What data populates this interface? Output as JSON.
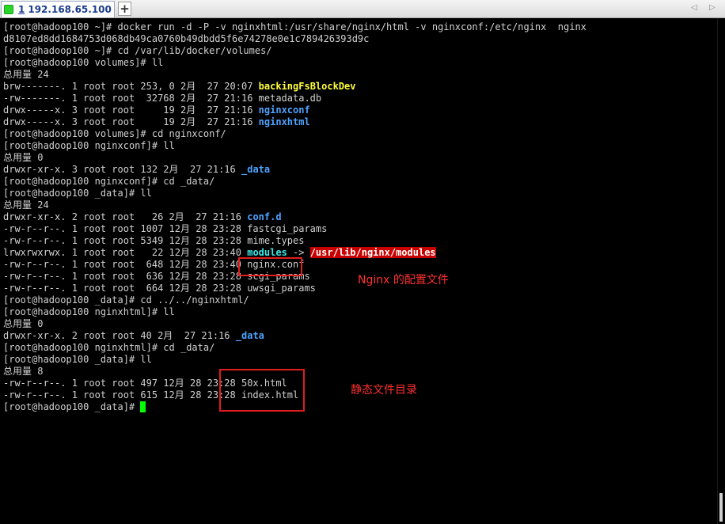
{
  "tab": {
    "number": "1",
    "title": "192.168.65.100",
    "close_glyph": "×",
    "add_glyph": "+",
    "nav_prev": "◁",
    "nav_next": "▷"
  },
  "colors": {
    "background": "#000000",
    "text": "#d0d0d0",
    "directory": "#4ea3ff",
    "device": "#ffff3c",
    "symlink": "#3ce8e8",
    "symlink_target_bg": "#c80000",
    "cursor": "#00ff00",
    "annotation": "#e01e1e"
  },
  "terminal": {
    "lines": [
      "[root@hadoop100 ~]# docker run -d -P -v nginxhtml:/usr/share/nginx/html -v nginxconf:/etc/nginx  nginx",
      "d8107ed8dd1684753d068db49ca0760b49dbdd5f6e74278e0e1c789426393d9c",
      "[root@hadoop100 ~]# cd /var/lib/docker/volumes/",
      "[root@hadoop100 volumes]# ll",
      "总用量 24",
      {
        "prefix": "brw-------. 1 root root 253, 0 2月  27 20:07 ",
        "name": "backingFsBlockDev",
        "type": "device"
      },
      "-rw-------. 1 root root  32768 2月  27 21:16 metadata.db",
      {
        "prefix": "drwx-----x. 3 root root     19 2月  27 21:16 ",
        "name": "nginxconf",
        "type": "directory"
      },
      {
        "prefix": "drwx-----x. 3 root root     19 2月  27 21:16 ",
        "name": "nginxhtml",
        "type": "directory"
      },
      "[root@hadoop100 volumes]# cd nginxconf/",
      "[root@hadoop100 nginxconf]# ll",
      "总用量 0",
      {
        "prefix": "drwxr-xr-x. 3 root root 132 2月  27 21:16 ",
        "name": "_data",
        "type": "directory"
      },
      "[root@hadoop100 nginxconf]# cd _data/",
      "[root@hadoop100 _data]# ll",
      "总用量 24",
      {
        "prefix": "drwxr-xr-x. 2 root root   26 2月  27 21:16 ",
        "name": "conf.d",
        "type": "directory"
      },
      "-rw-r--r--. 1 root root 1007 12月 28 23:28 fastcgi_params",
      "-rw-r--r--. 1 root root 5349 12月 28 23:28 mime.types",
      {
        "prefix": "lrwxrwxrwx. 1 root root   22 12月 28 23:40 ",
        "name": "modules",
        "arrow": " -> ",
        "target": "/usr/lib/nginx/modules",
        "type": "symlink"
      },
      "-rw-r--r--. 1 root root  648 12月 28 23:40 nginx.conf",
      "-rw-r--r--. 1 root root  636 12月 28 23:28 scgi_params",
      "-rw-r--r--. 1 root root  664 12月 28 23:28 uwsgi_params",
      "[root@hadoop100 _data]# cd ../../nginxhtml/",
      "[root@hadoop100 nginxhtml]# ll",
      "总用量 0",
      {
        "prefix": "drwxr-xr-x. 2 root root 40 2月  27 21:16 ",
        "name": "_data",
        "type": "directory"
      },
      "[root@hadoop100 nginxhtml]# cd _data/",
      "[root@hadoop100 _data]# ll",
      "总用量 8",
      "-rw-r--r--. 1 root root 497 12月 28 23:28 50x.html",
      "-rw-r--r--. 1 root root 615 12月 28 23:28 index.html",
      {
        "prefix": "[root@hadoop100 _data]# ",
        "type": "prompt"
      }
    ]
  },
  "annotations": {
    "nginx_conf_note": "Nginx 的配置文件",
    "static_files_note": "静态文件目录"
  }
}
